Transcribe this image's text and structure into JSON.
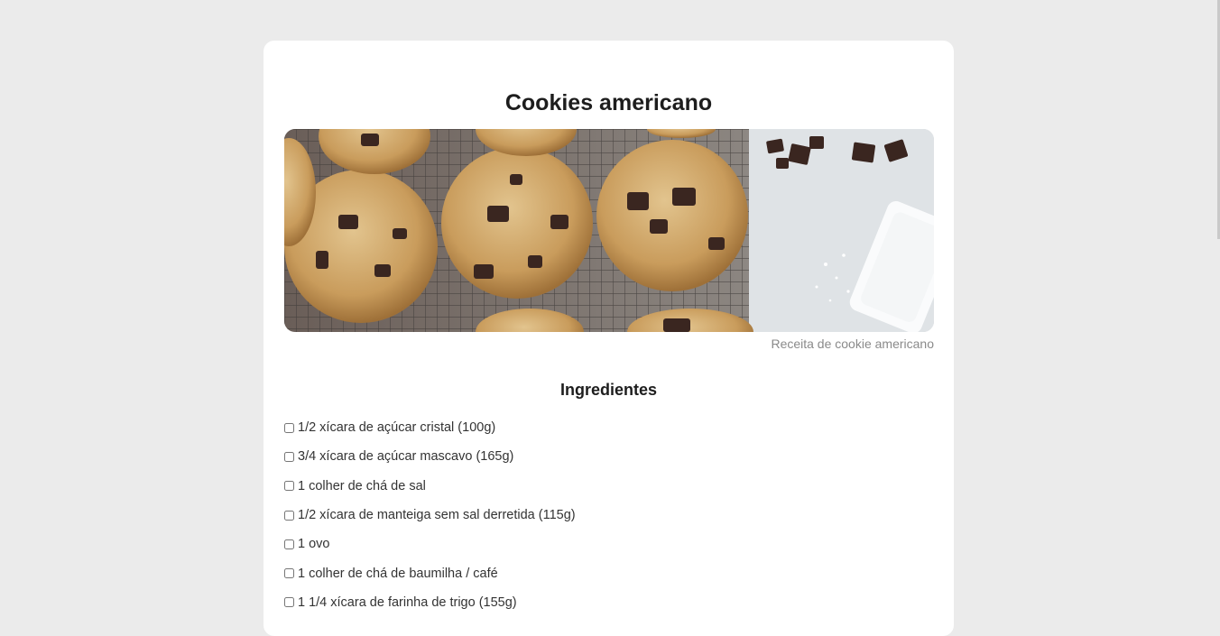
{
  "recipe": {
    "title": "Cookies americano",
    "image_caption": "Receita de cookie americano"
  },
  "ingredients_section": {
    "title": "Ingredientes",
    "items": [
      "1/2 xícara de açúcar cristal (100g)",
      "3/4 xícara de açúcar mascavo (165g)",
      "1 colher de chá de sal",
      "1/2 xícara de manteiga sem sal derretida (115g)",
      "1 ovo",
      "1 colher de chá de baumilha / café",
      "1 1/4 xícara de farinha de trigo (155g)"
    ]
  },
  "colors": {
    "page_background": "#ebebeb",
    "card_background": "#ffffff",
    "title_color": "#1d1d1d",
    "caption_color": "#8a8a8a"
  }
}
